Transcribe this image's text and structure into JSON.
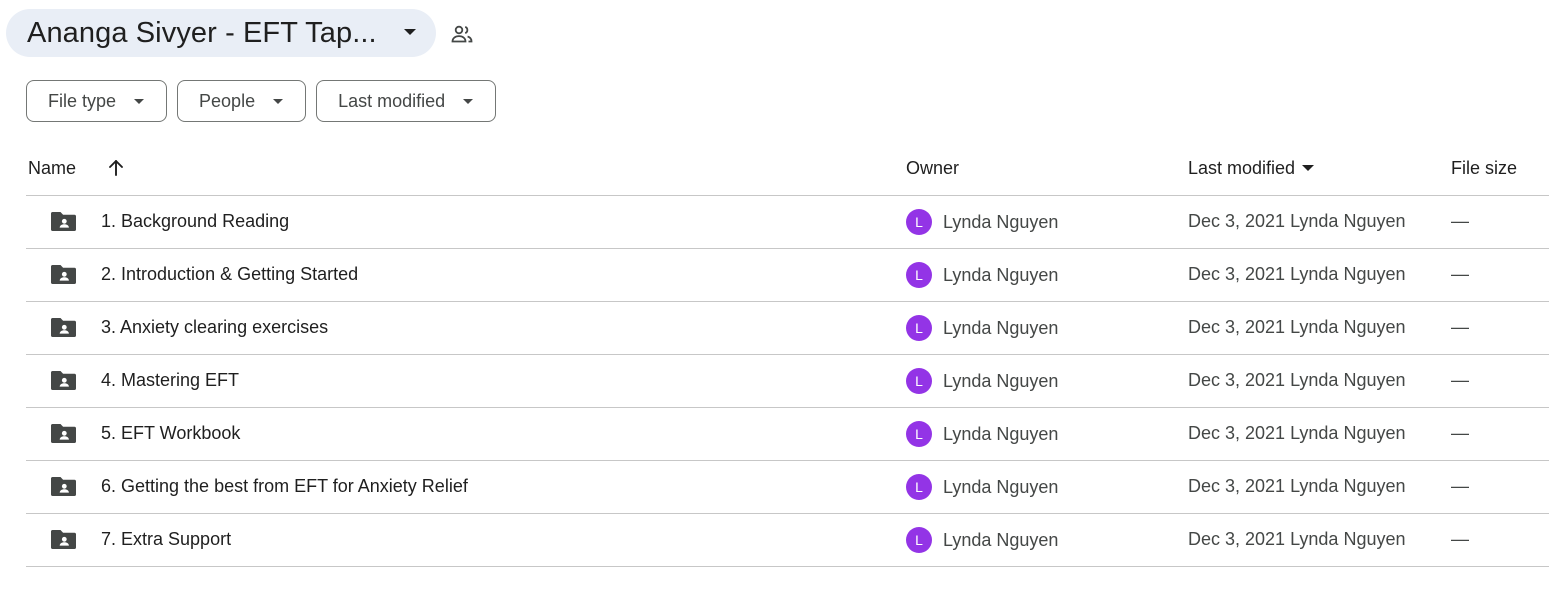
{
  "title": {
    "text": "Ananga Sivyer - EFT Tap...",
    "shared_icon": "people-icon"
  },
  "filters": [
    {
      "label": "File type"
    },
    {
      "label": "People"
    },
    {
      "label": "Last modified"
    }
  ],
  "table": {
    "headers": {
      "name": "Name",
      "owner": "Owner",
      "last_modified": "Last modified",
      "file_size": "File size"
    },
    "rows": [
      {
        "name": "1. Background Reading",
        "owner_initial": "L",
        "owner": "Lynda Nguyen",
        "modified": "Dec 3, 2021 Lynda Nguyen",
        "size": "—"
      },
      {
        "name": "2. Introduction & Getting Started",
        "owner_initial": "L",
        "owner": "Lynda Nguyen",
        "modified": "Dec 3, 2021 Lynda Nguyen",
        "size": "—"
      },
      {
        "name": "3. Anxiety clearing exercises",
        "owner_initial": "L",
        "owner": "Lynda Nguyen",
        "modified": "Dec 3, 2021 Lynda Nguyen",
        "size": "—"
      },
      {
        "name": "4. Mastering EFT",
        "owner_initial": "L",
        "owner": "Lynda Nguyen",
        "modified": "Dec 3, 2021 Lynda Nguyen",
        "size": "—"
      },
      {
        "name": "5. EFT Workbook",
        "owner_initial": "L",
        "owner": "Lynda Nguyen",
        "modified": "Dec 3, 2021 Lynda Nguyen",
        "size": "—"
      },
      {
        "name": "6. Getting the best from EFT for Anxiety Relief",
        "owner_initial": "L",
        "owner": "Lynda Nguyen",
        "modified": "Dec 3, 2021 Lynda Nguyen",
        "size": "—"
      },
      {
        "name": "7. Extra Support",
        "owner_initial": "L",
        "owner": "Lynda Nguyen",
        "modified": "Dec 3, 2021 Lynda Nguyen",
        "size": "—"
      }
    ]
  },
  "colors": {
    "title_chip_bg": "#e9eef6",
    "avatar_bg": "#9334e6",
    "divider": "#c7c7c7",
    "icon": "#444746"
  }
}
